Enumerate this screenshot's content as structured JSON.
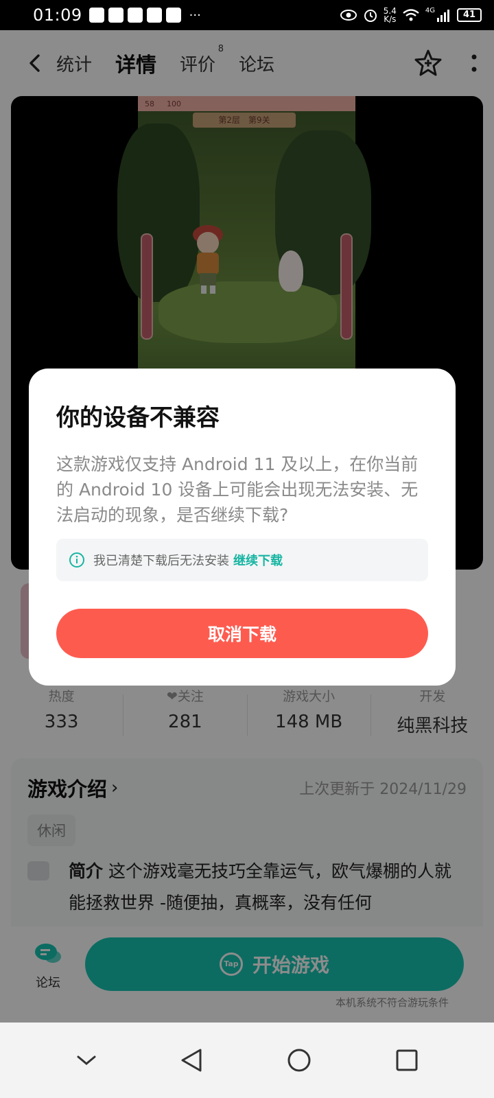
{
  "status_bar": {
    "time": "01:09",
    "overflow": "···",
    "net_speed_value": "5.4",
    "net_speed_unit": "K/s",
    "network": "4G",
    "battery": "41"
  },
  "header": {
    "tabs": [
      {
        "label": "统计"
      },
      {
        "label": "详情"
      },
      {
        "label": "评价",
        "badge": "8"
      },
      {
        "label": "论坛"
      }
    ]
  },
  "screenshot": {
    "gold": "58",
    "diamonds": "100",
    "stage": "第2层　第9关"
  },
  "stats": [
    {
      "label": "热度",
      "value": "333"
    },
    {
      "label": "关注",
      "value": "281"
    },
    {
      "label": "游戏大小",
      "value": "148 MB"
    },
    {
      "label": "开发",
      "value": "纯黑科技"
    }
  ],
  "intro": {
    "title": "游戏介绍",
    "updated": "上次更新于 2024/11/29",
    "tag": "休闲",
    "summary_label": "简介",
    "summary_text": " 这个游戏毫无技巧全靠运气，欧气爆棚的人就能拯救世界 -随便抽，真概率，没有任何"
  },
  "bottom": {
    "forum_label": "论坛",
    "start_label": "开始游戏",
    "badge": "Tap",
    "note": "本机系统不符合游玩条件"
  },
  "dialog": {
    "title": "你的设备不兼容",
    "message": "这款游戏仅支持 Android 11 及以上，在你当前的 Android 10 设备上可能会出现无法安装、无法启动的现象，是否继续下载?",
    "notice": "我已清楚下载后无法安装",
    "continue_label": "继续下载",
    "cancel_label": "取消下载"
  },
  "colors": {
    "accent": "#17c5b2",
    "cancel": "#fe5b4f"
  }
}
